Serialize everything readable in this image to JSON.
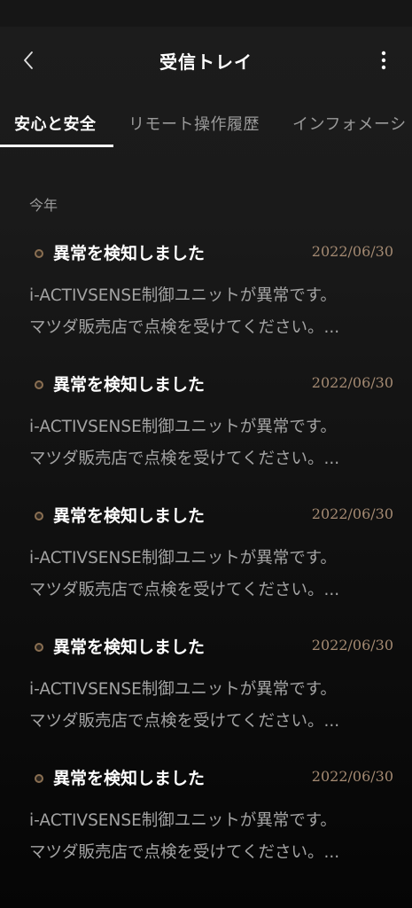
{
  "header": {
    "back_icon": "chevron-left-icon",
    "title": "受信トレイ",
    "more_icon": "more-vertical-icon"
  },
  "tabs": [
    {
      "label": "安心と安全",
      "active": true
    },
    {
      "label": "リモート操作履歴",
      "active": false
    },
    {
      "label": "インフォメーシ",
      "active": false
    }
  ],
  "section": {
    "label": "今年"
  },
  "messages": [
    {
      "title": "異常を検知しました",
      "date": "2022/06/30",
      "line1": "i-ACTIVSENSE制御ユニットが異常です。",
      "line2": "マツダ販売店で点検を受けてください。..."
    },
    {
      "title": "異常を検知しました",
      "date": "2022/06/30",
      "line1": "i-ACTIVSENSE制御ユニットが異常です。",
      "line2": "マツダ販売店で点検を受けてください。..."
    },
    {
      "title": "異常を検知しました",
      "date": "2022/06/30",
      "line1": "i-ACTIVSENSE制御ユニットが異常です。",
      "line2": "マツダ販売店で点検を受けてください。..."
    },
    {
      "title": "異常を検知しました",
      "date": "2022/06/30",
      "line1": "i-ACTIVSENSE制御ユニットが異常です。",
      "line2": "マツダ販売店で点検を受けてください。..."
    },
    {
      "title": "異常を検知しました",
      "date": "2022/06/30",
      "line1": "i-ACTIVSENSE制御ユニットが異常です。",
      "line2": "マツダ販売店で点検を受けてください。..."
    }
  ],
  "colors": {
    "accent_date": "#a48a72",
    "unread_dot": "#8a6f52"
  }
}
